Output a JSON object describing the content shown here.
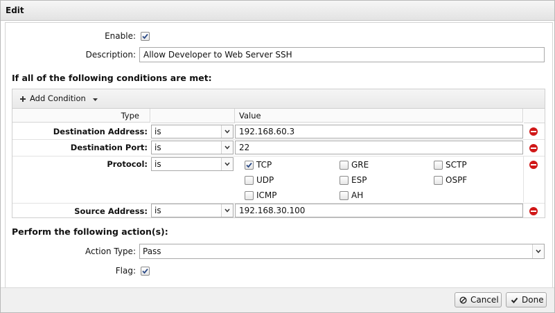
{
  "dialog": {
    "title": "Edit"
  },
  "form": {
    "enable_label": "Enable:",
    "enable_checked": true,
    "description_label": "Description:",
    "description_value": "Allow Developer to Web Server SSH"
  },
  "conditions": {
    "heading": "If all of the following conditions are met:",
    "add_condition_label": "Add Condition",
    "columns": {
      "type": "Type",
      "value": "Value"
    },
    "rows": [
      {
        "label": "Destination Address:",
        "operator": "is",
        "value": "192.168.60.3"
      },
      {
        "label": "Destination Port:",
        "operator": "is",
        "value": "22"
      },
      {
        "label": "Protocol:",
        "operator": "is",
        "value": ""
      },
      {
        "label": "Source Address:",
        "operator": "is",
        "value": "192.168.30.100"
      }
    ],
    "protocols": [
      {
        "label": "TCP",
        "checked": true
      },
      {
        "label": "GRE",
        "checked": false
      },
      {
        "label": "SCTP",
        "checked": false
      },
      {
        "label": "UDP",
        "checked": false
      },
      {
        "label": "ESP",
        "checked": false
      },
      {
        "label": "OSPF",
        "checked": false
      },
      {
        "label": "ICMP",
        "checked": false
      },
      {
        "label": "AH",
        "checked": false
      }
    ]
  },
  "actions": {
    "heading": "Perform the following action(s):",
    "action_type_label": "Action Type:",
    "action_type_value": "Pass",
    "flag_label": "Flag:",
    "flag_checked": true
  },
  "footer": {
    "cancel_label": "Cancel",
    "done_label": "Done"
  },
  "colors": {
    "remove": "#d01818",
    "border": "#a9a9a9"
  }
}
